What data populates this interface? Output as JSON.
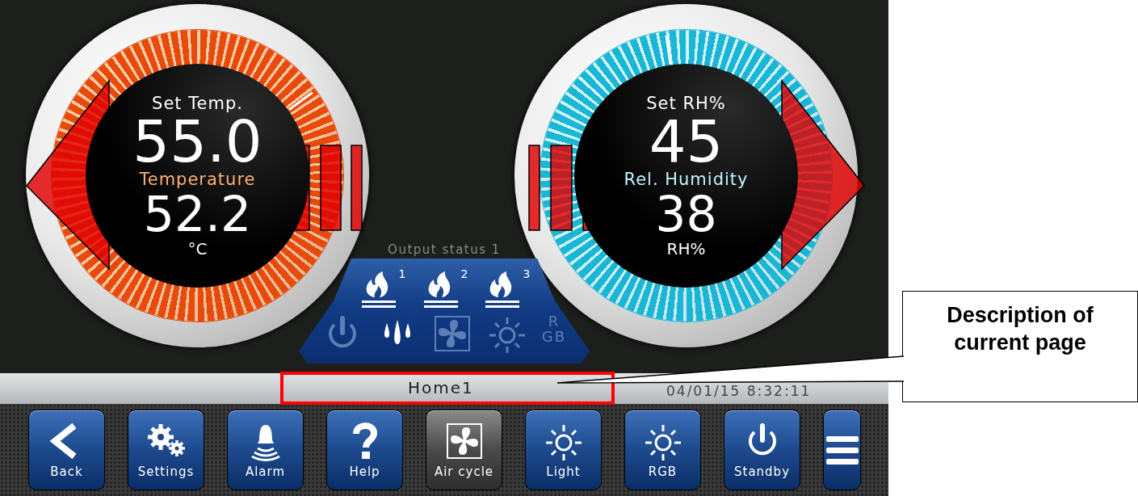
{
  "gauges": [
    {
      "kind": "temperature",
      "setpoint_label": "Set Temp.",
      "setpoint": "55.0",
      "label": "Temperature",
      "value": "52.2",
      "unit": "°C",
      "color": "#e84a0c"
    },
    {
      "kind": "humidity",
      "setpoint_label": "Set RH%",
      "setpoint": "45",
      "label": "Rel. Humidity",
      "value": "38",
      "unit": "RH%",
      "color": "#1ab6d6"
    }
  ],
  "output_status": {
    "title": "Output status 1",
    "outputs": [
      {
        "kind": "flame",
        "index": "1",
        "on": true
      },
      {
        "kind": "flame",
        "index": "2",
        "on": true
      },
      {
        "kind": "flame",
        "index": "3",
        "on": true
      },
      {
        "kind": "power",
        "on": false
      },
      {
        "kind": "drops",
        "on": true
      },
      {
        "kind": "fan",
        "on": false
      },
      {
        "kind": "sun",
        "on": false
      },
      {
        "kind": "rgb",
        "lines": [
          "R",
          "GB"
        ],
        "on": false
      }
    ]
  },
  "status_bar": {
    "page": "Home1",
    "datetime": "04/01/15 8:32:11"
  },
  "buttons": [
    {
      "kind": "back",
      "label": "Back",
      "selected": false
    },
    {
      "kind": "gears",
      "label": "Settings",
      "selected": false
    },
    {
      "kind": "bell",
      "label": "Alarm",
      "selected": false
    },
    {
      "kind": "help",
      "label": "Help",
      "selected": false
    },
    {
      "kind": "fan",
      "label": "Air cycle",
      "selected": true
    },
    {
      "kind": "sun",
      "label": "Light",
      "selected": false
    },
    {
      "kind": "sun",
      "label": "RGB",
      "selected": false
    },
    {
      "kind": "power",
      "label": "Standby",
      "selected": false
    },
    {
      "kind": "menu",
      "selected": false
    }
  ],
  "annotation": {
    "callout": "Description of current page"
  }
}
